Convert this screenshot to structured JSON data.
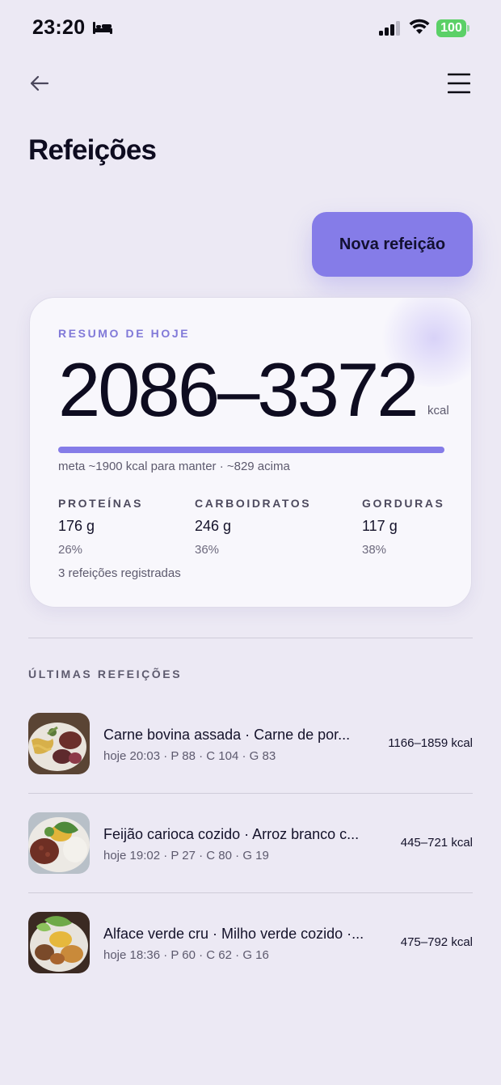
{
  "status_bar": {
    "time": "23:20",
    "sleep_icon": "bed-icon",
    "signal_icon": "cellular-signal-icon",
    "wifi_icon": "wifi-icon",
    "battery_level": "100",
    "battery_color": "#5bd067"
  },
  "nav": {
    "back_icon": "arrow-left-icon",
    "menu_icon": "hamburger-menu-icon"
  },
  "page": {
    "title": "Refeições",
    "new_meal_label": "Nova refeição",
    "accent_color": "#857ce8"
  },
  "summary": {
    "label": "RESUMO DE HOJE",
    "kcal_range": "2086–3372",
    "kcal_unit": "kcal",
    "progress_fraction": 1.0,
    "goal_text": "meta ~1900 kcal para manter · ~829 acima",
    "macros": [
      {
        "label": "PROTEÍNAS",
        "value": "176 g",
        "percent": "26%"
      },
      {
        "label": "CARBOIDRATOS",
        "value": "246 g",
        "percent": "36%"
      },
      {
        "label": "GORDURAS",
        "value": "117 g",
        "percent": "38%"
      }
    ],
    "meal_count": "3 refeições registradas"
  },
  "recent": {
    "title": "ÚLTIMAS REFEIÇÕES",
    "meals": [
      {
        "name": "Carne bovina assada · Carne de por...",
        "meta": "hoje 20:03 · P 88 · C 104 · G 83",
        "kcal": "1166–1859 kcal",
        "thumb_icon": "meal-photo-icon"
      },
      {
        "name": "Feijão carioca cozido · Arroz branco c...",
        "meta": "hoje 19:02 · P 27 · C 80 · G 19",
        "kcal": "445–721 kcal",
        "thumb_icon": "meal-photo-icon"
      },
      {
        "name": "Alface verde cru · Milho verde cozido ·...",
        "meta": "hoje 18:36 · P 60 · C 62 · G 16",
        "kcal": "475–792 kcal",
        "thumb_icon": "meal-photo-icon"
      }
    ]
  }
}
